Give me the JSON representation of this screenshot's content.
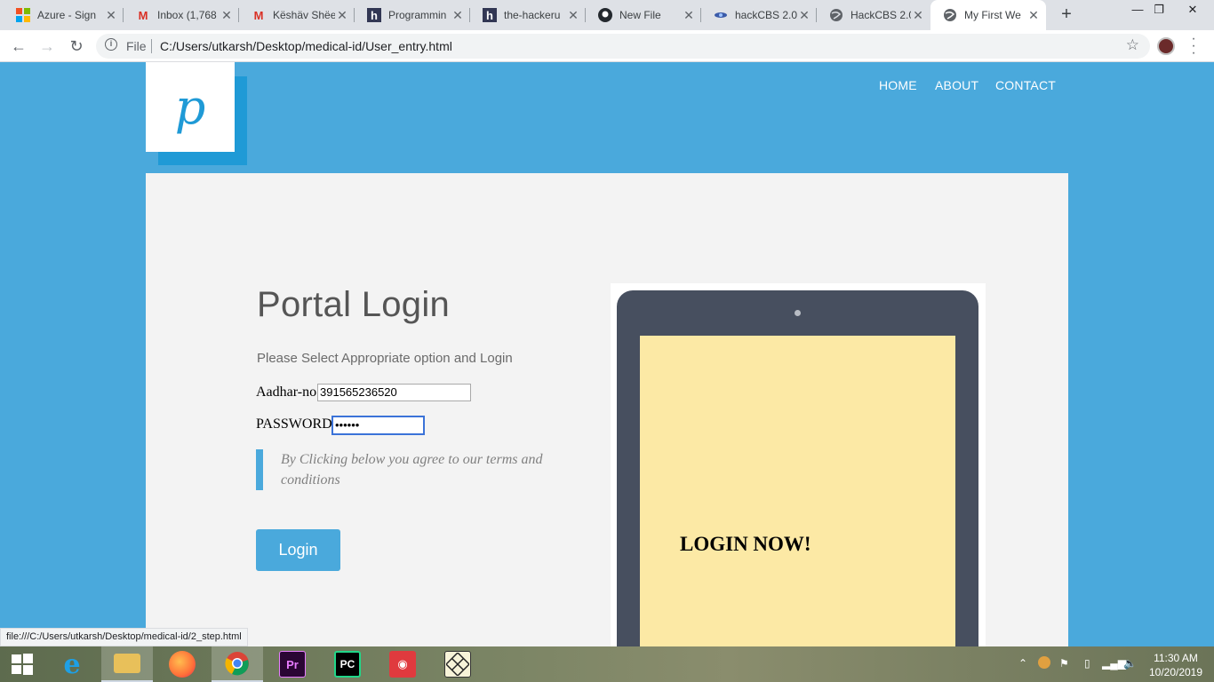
{
  "browser": {
    "tabs": [
      {
        "title": "Azure - Sign",
        "icon": "microsoft-icon"
      },
      {
        "title": "Inbox (1,768",
        "icon": "gmail-icon"
      },
      {
        "title": "Këshäv Shëe",
        "icon": "gmail-icon"
      },
      {
        "title": "Programmin",
        "icon": "hackerearth-icon"
      },
      {
        "title": "the-hackeru",
        "icon": "hackerearth-icon"
      },
      {
        "title": "New File",
        "icon": "github-icon"
      },
      {
        "title": "hackCBS 2.0",
        "icon": "hackcbs-icon"
      },
      {
        "title": "HackCBS 2.0",
        "icon": "globe-icon"
      },
      {
        "title": "My First We",
        "icon": "globe-icon"
      }
    ],
    "address": {
      "scheme": "File",
      "url": "C:/Users/utkarsh/Desktop/medical-id/User_entry.html"
    },
    "status_url": "file:///C:/Users/utkarsh/Desktop/medical-id/2_step.html"
  },
  "site": {
    "logo_letter": "p",
    "nav": [
      "HOME",
      "ABOUT",
      "CONTACT"
    ],
    "heading": "Portal Login",
    "subtitle": "Please Select Appropriate option and Login",
    "aadhar_label": "Aadhar-no",
    "aadhar_value": "391565236520",
    "password_label": "PASSWORD",
    "password_value": "••••••",
    "terms": "By Clicking below you agree to our terms and conditions",
    "login_button": "Login",
    "tablet_text": "LOGIN NOW!"
  },
  "taskbar": {
    "time": "11:30 AM",
    "date": "10/20/2019"
  },
  "colors": {
    "page_background": "#4aa9dc",
    "logo_accent": "#1f9ad6",
    "tablet_frame": "#474f5f",
    "tablet_screen": "#fce9a5"
  }
}
